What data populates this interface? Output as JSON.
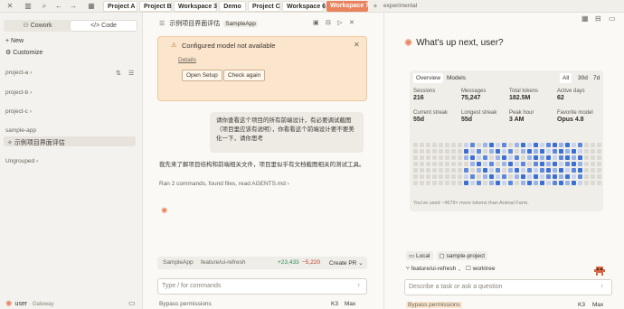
{
  "topbar": {
    "tabs": [
      "Project A",
      "Project B",
      "Workspace 3",
      "Demo",
      "Project C",
      "Workspace 6",
      "Workspace 7"
    ],
    "active_tab": "Workspace 7",
    "tag": "experimental"
  },
  "sidebar": {
    "mode_tabs": [
      "Cowork",
      "Code"
    ],
    "actions": [
      "New",
      "Customize"
    ],
    "groups": [
      "project-a",
      "project-b",
      "project-c",
      "sample-app"
    ],
    "active_session": "示例项目界面评估",
    "ungrouped": "Ungrouped",
    "user": {
      "name": "user",
      "gateway": "· Gateway"
    }
  },
  "chat": {
    "title": "示例项目界面评估",
    "app_badge": "SampleApp",
    "banner": {
      "title": "Configured model not available",
      "details": "Details",
      "buttons": [
        "Open Setup",
        "Check again"
      ]
    },
    "user_message": "请你查看这个项目的所有前端设计，有必要调试截图（项目里应该有说明），你看看这个前端设计要不要美化一下，请你思考",
    "assistant_message": "我先来了解项目结构和前端相关文件，项目里似乎有文档截图相关的测试工具。",
    "tool_summary": "Ran 2 commands, found files, read AGENTS.md",
    "footer": {
      "app": "SampleApp",
      "branch": "feature/ui-refresh",
      "added": "+23,433",
      "removed": "−5,220",
      "pr": "Create PR"
    },
    "input_placeholder": "Type / for commands",
    "bottom": {
      "permissions": "Bypass permissions",
      "k": "K3",
      "effort": "Max"
    }
  },
  "panel": {
    "greeting": "What's up next, user?",
    "tabs": [
      "Overview",
      "Models"
    ],
    "ranges": [
      "All",
      "30d",
      "7d"
    ],
    "stats": [
      {
        "label": "Sessions",
        "value": "216"
      },
      {
        "label": "Messages",
        "value": "75,247"
      },
      {
        "label": "Total tokens",
        "value": "182.5M"
      },
      {
        "label": "Active days",
        "value": "62"
      },
      {
        "label": "Current streak",
        "value": "55d"
      },
      {
        "label": "Longest streak",
        "value": "55d"
      },
      {
        "label": "Peak hour",
        "value": "3 AM"
      },
      {
        "label": "Favorite model",
        "value": "Opus 4.8"
      }
    ],
    "footnote": "You've used ~4679× more tokens than Animal Farm.",
    "env": {
      "local": "Local",
      "project": "sample-project",
      "branch": "feature/ui-refresh",
      "worktree": "worktree"
    },
    "input_placeholder": "Describe a task or ask a question",
    "bottom": {
      "permissions": "Bypass permissions",
      "k": "K3",
      "effort": "Max"
    }
  },
  "colors": {
    "accent": "#e8835e",
    "banner_bg": "#fbe5cc",
    "heat": "#3b6fd4",
    "green": "#2e8b57",
    "red": "#c0392b"
  }
}
